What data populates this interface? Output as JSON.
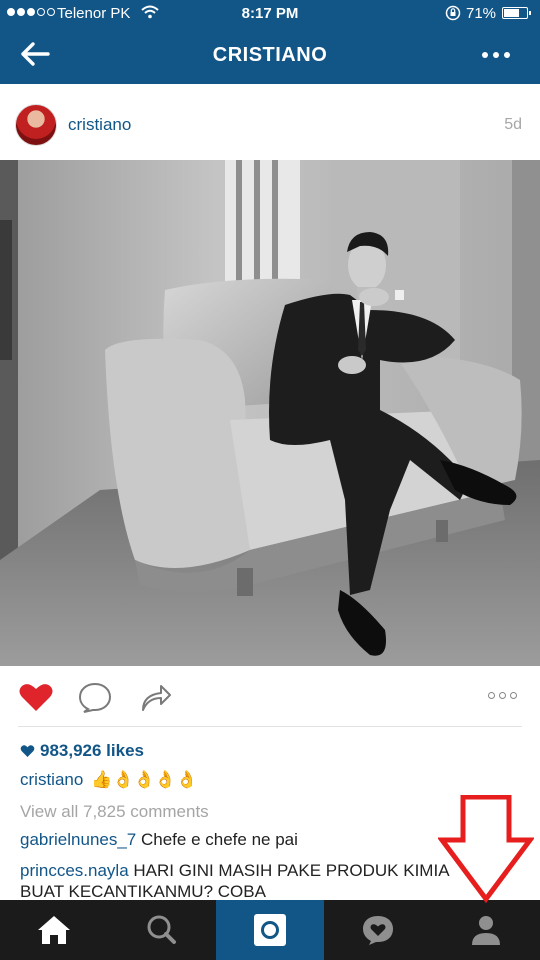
{
  "status_bar": {
    "carrier": "Telenor PK",
    "time": "8:17 PM",
    "battery_percent": "71%",
    "battery_level": 0.71,
    "signal_bars_filled": 3,
    "signal_bars_total": 5
  },
  "header": {
    "title": "CRISTIANO",
    "back_icon": "back-arrow-icon",
    "more_icon": "more-dots-icon",
    "color": "#125688"
  },
  "post": {
    "username": "cristiano",
    "time_ago": "5d",
    "liked": true,
    "likes": "983,926 likes",
    "caption_user": "cristiano",
    "caption_text": "👍👌👌👌👌",
    "view_all": "View all 7,825 comments",
    "comments": [
      {
        "user": "gabrielnunes_7",
        "text": "Chefe e chefe ne pai"
      },
      {
        "user": "princces.nayla",
        "text": "HARI GINI MASIH PAKE PRODUK KIMIA BUAT KECANTIKANMU? COBA"
      }
    ]
  },
  "tab_bar": {
    "items": [
      {
        "name": "home",
        "icon": "home-icon",
        "active": false
      },
      {
        "name": "search",
        "icon": "search-icon",
        "active": false
      },
      {
        "name": "camera",
        "icon": "camera-icon",
        "active": true
      },
      {
        "name": "activity",
        "icon": "activity-heart-icon",
        "active": false
      },
      {
        "name": "profile",
        "icon": "profile-icon",
        "active": false
      }
    ]
  },
  "colors": {
    "brand": "#125688",
    "like_red": "#e0242c",
    "annotation_red": "#e61e1e",
    "tabbar": "#1b1b1b"
  }
}
